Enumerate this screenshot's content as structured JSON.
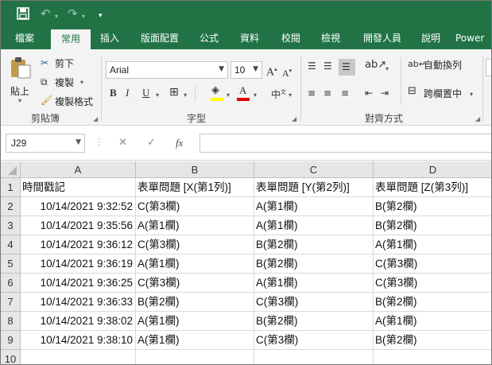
{
  "app": {
    "colors": {
      "brand": "#217346",
      "ribbon": "#f3f3f3",
      "header": "#e6e6e6"
    },
    "qat": {
      "save_icon": "save-icon",
      "undo_icon": "undo-icon",
      "redo_icon": "redo-icon",
      "customize_icon": "chevron-down-icon"
    }
  },
  "tabs": [
    {
      "label": "檔案"
    },
    {
      "label": "常用"
    },
    {
      "label": "插入"
    },
    {
      "label": "版面配置"
    },
    {
      "label": "公式"
    },
    {
      "label": "資料"
    },
    {
      "label": "校閱"
    },
    {
      "label": "檢視"
    },
    {
      "label": "開發人員"
    },
    {
      "label": "說明"
    },
    {
      "label": "Power"
    }
  ],
  "active_tab": "常用",
  "ribbon": {
    "clipboard": {
      "paste": "貼上",
      "cut": "剪下",
      "copy": "複製",
      "format_painter": "複製格式",
      "label": "剪貼簿"
    },
    "font": {
      "name": "Arial",
      "size": "10",
      "bold": "B",
      "italic": "I",
      "underline": "U",
      "font_color_glyph": "A",
      "label": "字型"
    },
    "alignment": {
      "wrap": "自動換列",
      "merge": "跨欄置中",
      "label": "對齊方式"
    }
  },
  "formula_bar": {
    "name_box": "J29",
    "cancel": "✕",
    "enter": "✓",
    "fx": "fx",
    "value": ""
  },
  "sheet": {
    "columns": [
      "A",
      "B",
      "C",
      "D"
    ],
    "row_numbers": [
      "1",
      "2",
      "3",
      "4",
      "5",
      "6",
      "7",
      "8",
      "9",
      "10"
    ],
    "header_row": [
      "時間戳記",
      "表單問題 [X(第1列)]",
      "表單問題 [Y(第2列)]",
      "表單問題 [Z(第3列)]"
    ],
    "rows": [
      [
        "10/14/2021 9:32:52",
        "C(第3欄)",
        "A(第1欄)",
        "B(第2欄)"
      ],
      [
        "10/14/2021 9:35:56",
        "A(第1欄)",
        "A(第1欄)",
        "B(第2欄)"
      ],
      [
        "10/14/2021 9:36:12",
        "C(第3欄)",
        "B(第2欄)",
        "A(第1欄)"
      ],
      [
        "10/14/2021 9:36:19",
        "A(第1欄)",
        "B(第2欄)",
        "C(第3欄)"
      ],
      [
        "10/14/2021 9:36:25",
        "C(第3欄)",
        "A(第1欄)",
        "C(第3欄)"
      ],
      [
        "10/14/2021 9:36:33",
        "B(第2欄)",
        "C(第3欄)",
        "B(第2欄)"
      ],
      [
        "10/14/2021 9:38:02",
        "A(第1欄)",
        "B(第2欄)",
        "A(第1欄)"
      ],
      [
        "10/14/2021 9:38:10",
        "A(第1欄)",
        "C(第3欄)",
        "B(第2欄)"
      ]
    ]
  }
}
